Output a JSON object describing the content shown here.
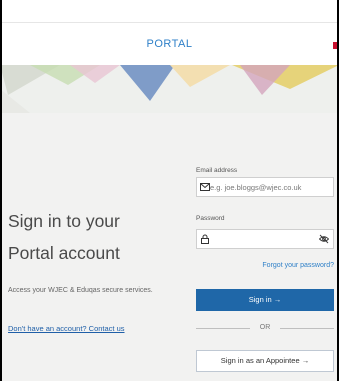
{
  "header": {
    "brand": "PORTAL"
  },
  "hero": {
    "title_line1": "Sign in to your",
    "title_line2": "Portal account",
    "subtitle": "Access your WJEC & Eduqas secure services.",
    "contact_link": "Don't have an account? Contact us"
  },
  "form": {
    "email_label": "Email address",
    "email_placeholder": "e.g. joe.bloggs@wjec.co.uk",
    "password_label": "Password",
    "forgot_link": "Forgot your password?",
    "sign_in_label": "Sign in →",
    "or_text": "OR",
    "appointee_label": "Sign in as an Appointee →"
  },
  "colors": {
    "primary": "#1f67a8",
    "link": "#2f80c8"
  }
}
